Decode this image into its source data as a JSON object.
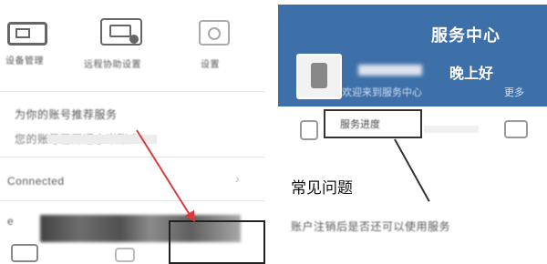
{
  "left": {
    "items": [
      {
        "label": "设备管理"
      },
      {
        "label": "远程协助设置"
      },
      {
        "label": "设置"
      }
    ],
    "section_line1": "为你的账号推荐服务",
    "section_line2": "您的账号已开通小米账户",
    "row_label": "Connected",
    "chevron": "›",
    "bottom_prefix": "e"
  },
  "right": {
    "header_title": "服务中心",
    "greeting": "晚上好",
    "subtext": "欢迎来到服务中心",
    "subtext_more": "更多",
    "tab_label": "服务进度",
    "faq_title": "常见问题",
    "faq_item": "账户注销后是否还可以使用服务"
  },
  "colors": {
    "header_bg": "#3d6fa8",
    "highlight_red": "#d93a3a"
  }
}
